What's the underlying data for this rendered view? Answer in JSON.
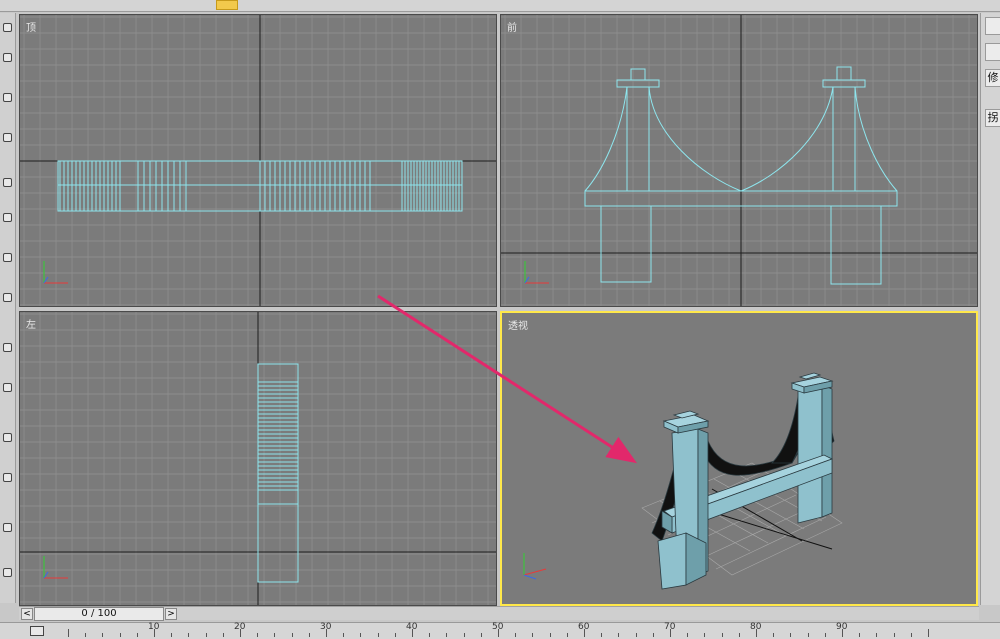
{
  "viewports": {
    "top": {
      "label": "顶"
    },
    "front": {
      "label": "前"
    },
    "left": {
      "label": "左"
    },
    "perspective": {
      "label": "透视"
    }
  },
  "time_slider": {
    "position_text": "0 / 100",
    "prev_glyph": "<",
    "next_glyph": ">"
  },
  "command_panel": {
    "tab_modify": "修",
    "tab_other": "拐"
  },
  "track_bar": {
    "ticks": [
      "10",
      "20",
      "30",
      "40",
      "50",
      "60",
      "70",
      "80",
      "90"
    ]
  },
  "colors": {
    "viewport_bg": "#7b7b7b",
    "wire": "#8ee6ee",
    "grid_minor": "#929292",
    "grid_major": "#1e1e1e",
    "active_border": "#ffe84a",
    "arrow": "#e2286b",
    "model_fill": "#8fc1cd",
    "model_dark": "#111111"
  },
  "icons": [
    "axis-tripod-icon",
    "pointer-arrow-annotation",
    "select-tool-icon",
    "move-tool-icon"
  ]
}
